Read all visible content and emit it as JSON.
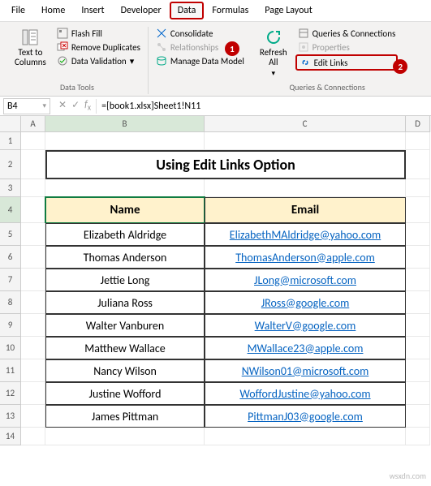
{
  "menu": {
    "items": [
      "File",
      "Home",
      "Insert",
      "Developer",
      "Data",
      "Formulas",
      "Page Layout"
    ],
    "active_index": 4
  },
  "ribbon": {
    "group1": {
      "big_button": {
        "label": "Text to\nColumns"
      },
      "items": [
        "Flash Fill",
        "Remove Duplicates",
        "Data Validation"
      ],
      "label": "Data Tools"
    },
    "group2": {
      "items": [
        "Consolidate",
        "Relationships",
        "Manage Data Model"
      ]
    },
    "group3": {
      "big_button": {
        "label": "Refresh\nAll"
      },
      "items": [
        "Queries & Connections",
        "Properties",
        "Edit Links"
      ],
      "label": "Queries & Connections"
    }
  },
  "badges": {
    "one": "1",
    "two": "2"
  },
  "namebox": "B4",
  "formula": "=[book1.xlsx]Sheet1!N11",
  "columns": [
    "A",
    "B",
    "C",
    "D"
  ],
  "row_count": 14,
  "title": "Using Edit Links Option",
  "headers": {
    "name": "Name",
    "email": "Email"
  },
  "chart_data": {
    "type": "table",
    "columns": [
      "Name",
      "Email"
    ],
    "rows": [
      {
        "name": "Elizabeth Aldridge",
        "email": "ElizabethMAldridge@yahoo.com"
      },
      {
        "name": "Thomas Anderson",
        "email": "ThomasAnderson@apple.com"
      },
      {
        "name": "Jettie Long",
        "email": "JLong@microsoft.com"
      },
      {
        "name": "Juliana Ross",
        "email": "JRoss@google.com"
      },
      {
        "name": "Walter Vanburen",
        "email": "WalterV@google.com"
      },
      {
        "name": "Matthew Wallace",
        "email": "MWallace23@apple.com"
      },
      {
        "name": "Nancy Wilson",
        "email": "NWilson01@microsoft.com"
      },
      {
        "name": "Justine Wofford",
        "email": "WoffordJustine@yahoo.com"
      },
      {
        "name": "James Pittman",
        "email": "PittmanJ03@google.com"
      }
    ]
  },
  "watermark": "wsxdn.com"
}
